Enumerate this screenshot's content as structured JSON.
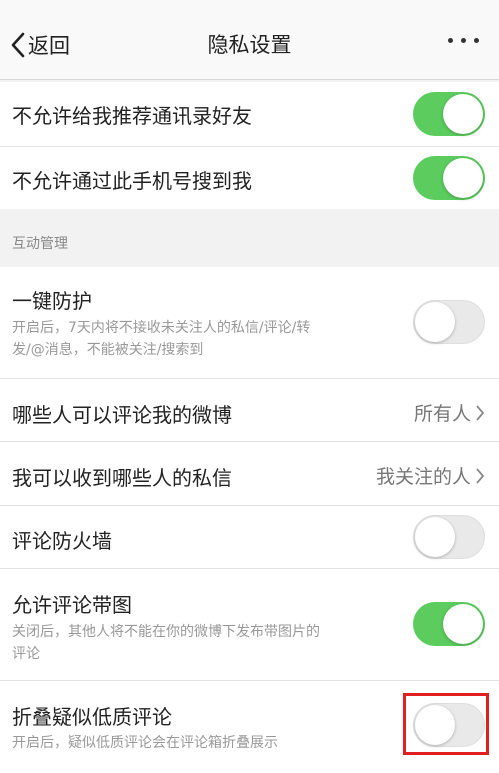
{
  "navbar": {
    "back_label": "返回",
    "title": "隐私设置"
  },
  "rows": {
    "no_recommend": {
      "label": "不允许给我推荐通讯录好友",
      "toggle": "on"
    },
    "no_phone_search": {
      "label": "不允许通过此手机号搜到我",
      "toggle": "on"
    },
    "interaction_header": "互动管理",
    "one_key_protect": {
      "label": "一键防护",
      "desc_line1": "开启后，7天内将不接收未关注人的私信/评论/转",
      "desc_line2": "发/@消息，不能被关注/搜索到",
      "toggle": "off"
    },
    "who_can_comment": {
      "label": "哪些人可以评论我的微博",
      "value": "所有人"
    },
    "who_can_message": {
      "label": "我可以收到哪些人的私信",
      "value": "我关注的人"
    },
    "comment_firewall": {
      "label": "评论防火墙",
      "toggle": "off"
    },
    "comment_images": {
      "label": "允许评论带图",
      "desc_line1": "关闭后，其他人将不能在你的微博下发布带图片的",
      "desc_line2": "评论",
      "toggle": "on"
    },
    "fold_low_quality": {
      "label": "折叠疑似低质评论",
      "desc_line1": "开启后，疑似低质评论会在评论箱折叠展示",
      "toggle": "off"
    }
  },
  "colors": {
    "toggle_on": "#5bcc5d",
    "toggle_off": "#e9e9e9",
    "highlight": "#e02020"
  }
}
